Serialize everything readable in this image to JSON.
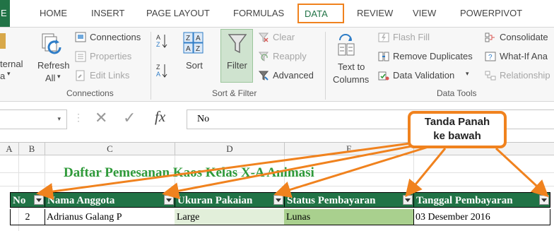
{
  "ribbon_tabs": {
    "file": "E",
    "home": "HOME",
    "insert": "INSERT",
    "page_layout": "PAGE LAYOUT",
    "formulas": "FORMULAS",
    "data": "DATA",
    "review": "REVIEW",
    "view": "VIEW",
    "powerpivot": "POWERPIVOT"
  },
  "ribbon": {
    "external_line1": "ternal",
    "external_line2": "a",
    "refresh_line1": "Refresh",
    "refresh_line2": "All",
    "connections": "Connections",
    "properties": "Properties",
    "edit_links": "Edit Links",
    "connections_group": "Connections",
    "sort": "Sort",
    "filter": "Filter",
    "clear": "Clear",
    "reapply": "Reapply",
    "advanced": "Advanced",
    "sort_filter_group": "Sort & Filter",
    "text_to_line1": "Text to",
    "text_to_line2": "Columns",
    "flash_fill": "Flash Fill",
    "remove_duplicates": "Remove Duplicates",
    "data_validation": "Data Validation",
    "consolidate": "Consolidate",
    "what_if": "What-If Ana",
    "relationships": "Relationship",
    "data_tools_group": "Data Tools"
  },
  "formula_bar": {
    "cancel": "✕",
    "enter": "✓",
    "fx": "fx",
    "content": "No"
  },
  "columns": [
    "A",
    "B",
    "C",
    "D",
    "E"
  ],
  "sheet": {
    "title": "Daftar Pemesanan Kaos Kelas X-A Animasi",
    "headers": [
      "No",
      "Nama Anggota",
      "Ukuran Pakaian",
      "Status Pembayaran",
      "Tanggal Pembayaran"
    ],
    "row": [
      "2",
      "Adrianus Galang P",
      "Large",
      "Lunas",
      "03 Desember 2016"
    ]
  },
  "callout": {
    "line1": "Tanda Panah",
    "line2": "ke bawah"
  },
  "colors": {
    "excel_green": "#217346",
    "accent_orange": "#f0821e",
    "title_green": "#2f9a3a"
  }
}
